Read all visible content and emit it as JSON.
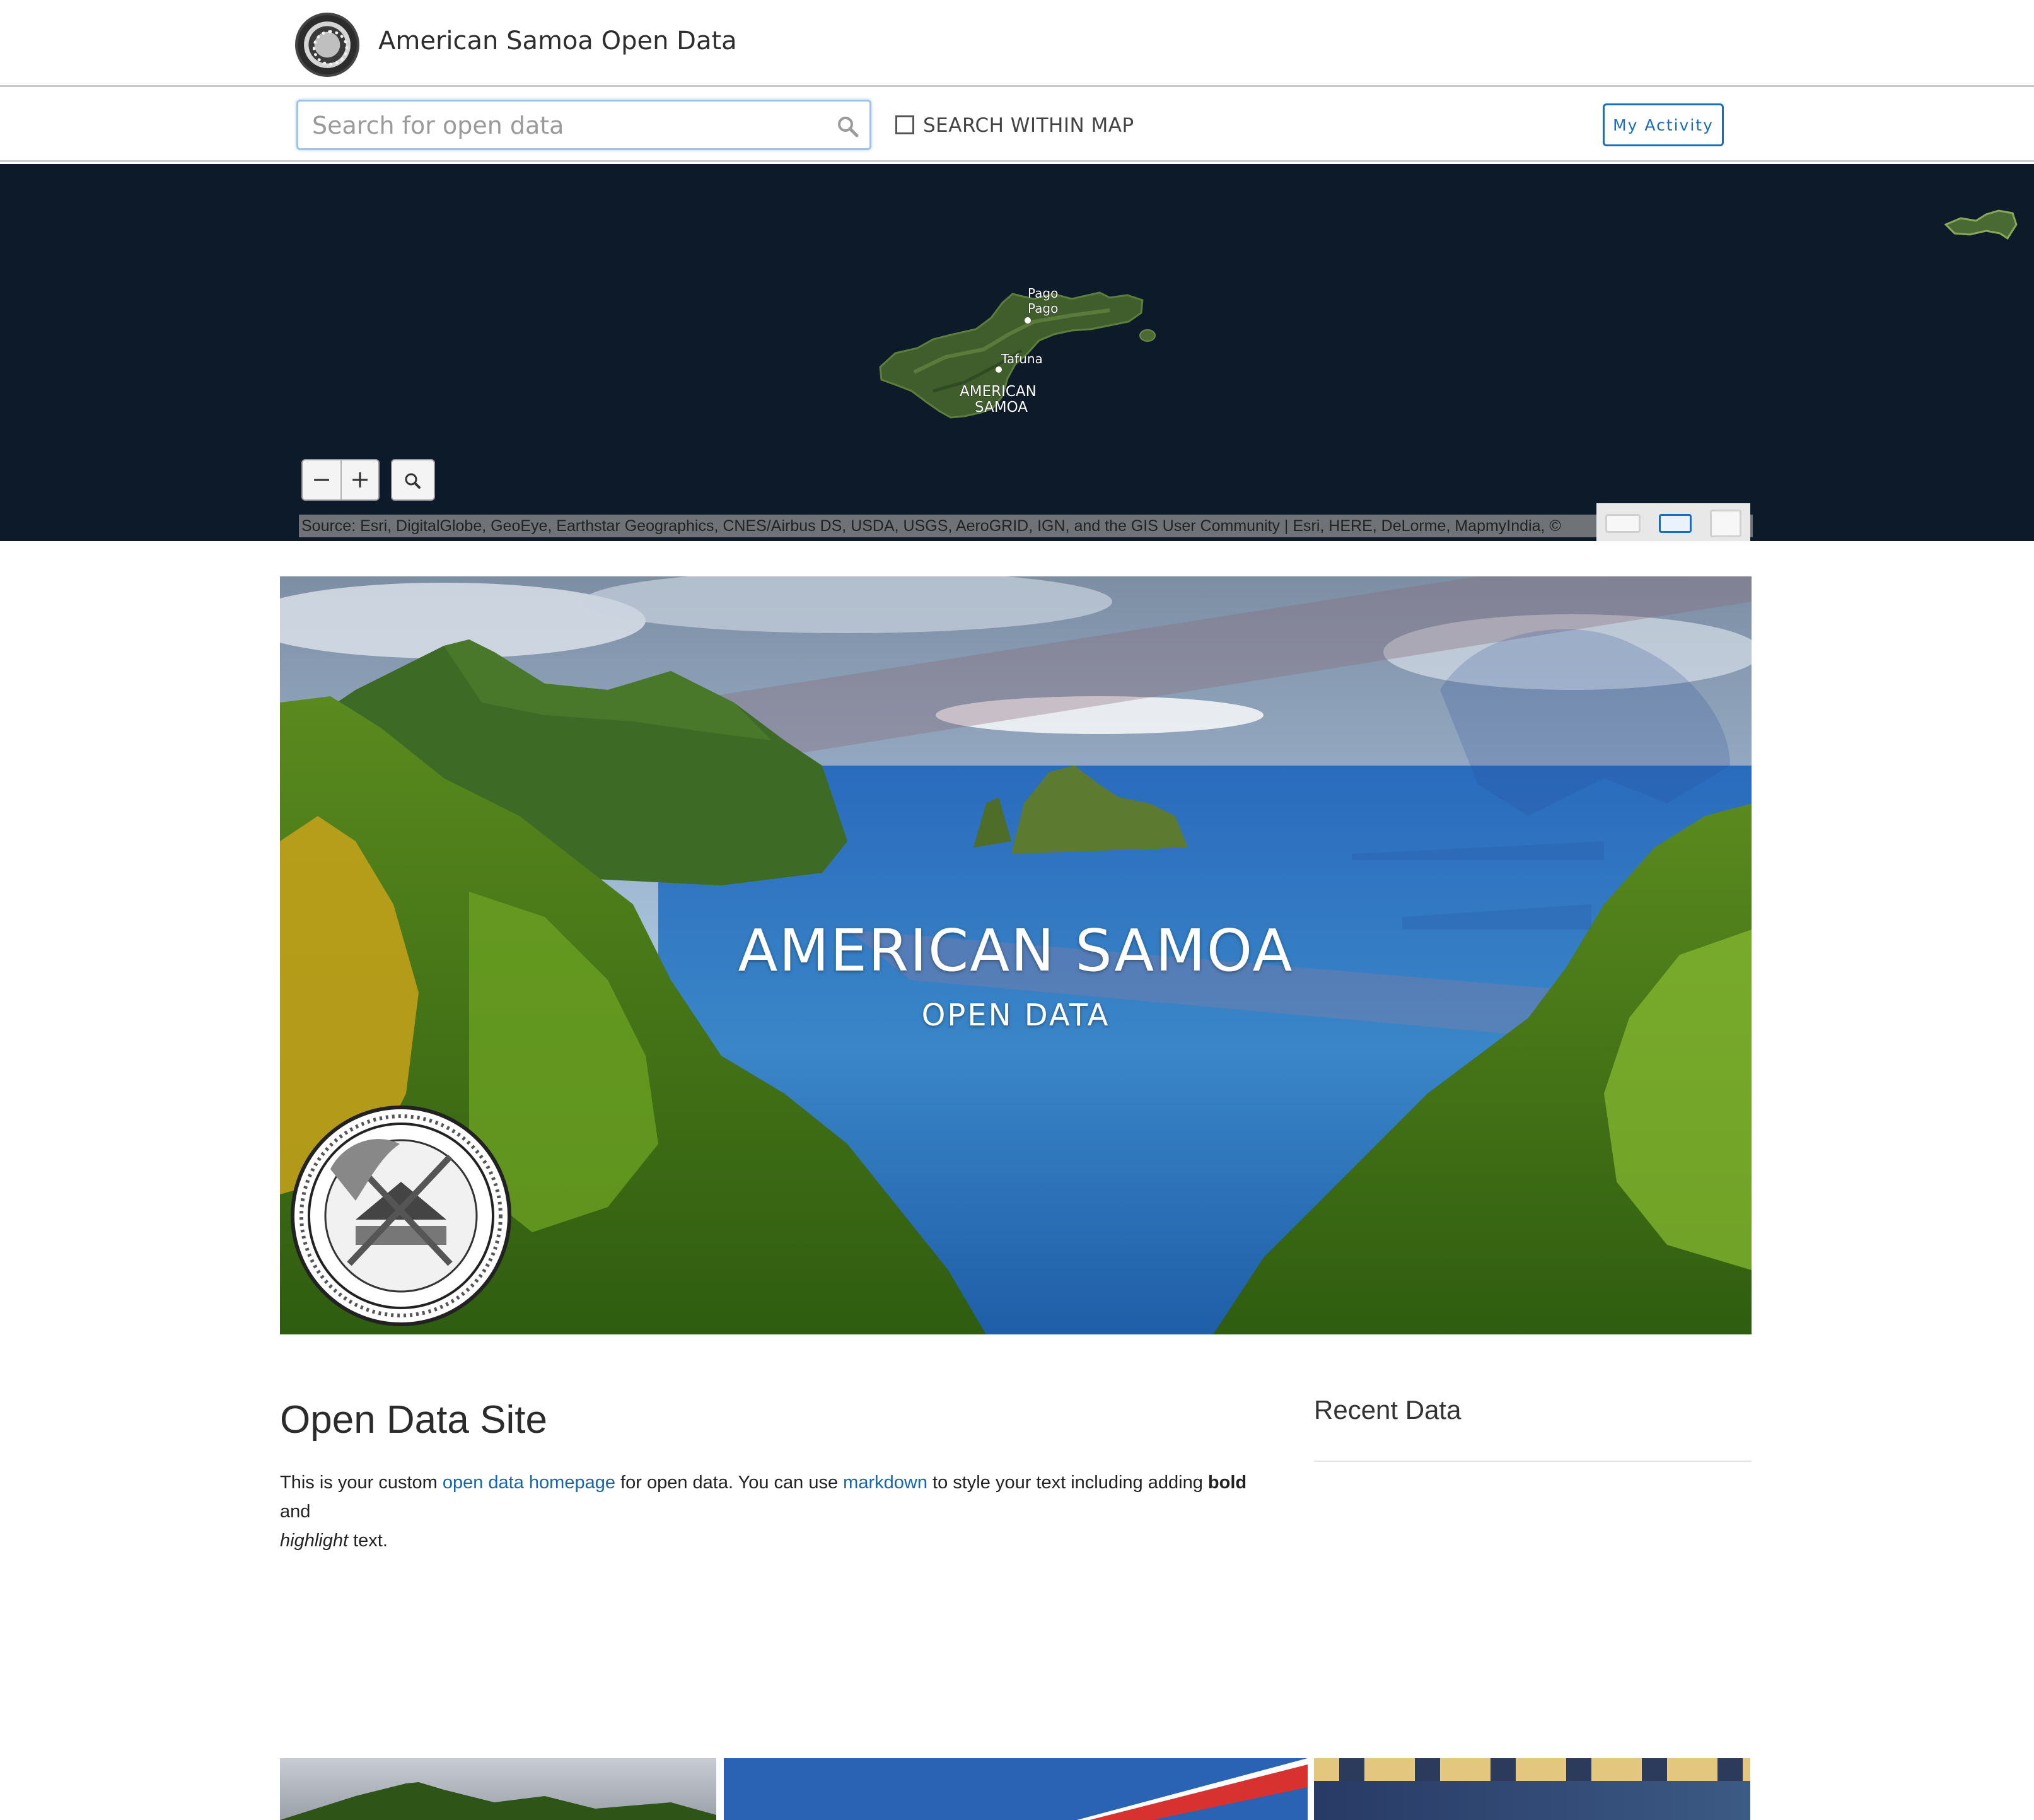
{
  "header": {
    "site_title": "American Samoa Open Data",
    "logo_icon": "american-samoa-seal-icon"
  },
  "toolbar": {
    "search_placeholder": "Search for open data",
    "search_icon": "search-icon",
    "search_within_map_label": "SEARCH WITHIN MAP",
    "search_within_map_checked": false,
    "my_activity_label": "My Activity",
    "accent_color": "#1a6db8"
  },
  "map": {
    "place_labels": {
      "pago_pago_line1": "Pago",
      "pago_pago_line2": "Pago",
      "tafuna": "Tafuna",
      "territory_line1": "AMERICAN",
      "territory_line2": "SAMOA"
    },
    "zoom_out_label": "−",
    "zoom_in_label": "+",
    "attribution": "Source: Esri, DigitalGlobe, GeoEye, Earthstar Geographics, CNES/Airbus DS, USDA, USGS, AeroGRID, IGN, and the GIS User Community |  Esri, HERE, DeLorme, MapmyIndia, ©",
    "basemap_options": [
      "streets",
      "imagery",
      "topographic"
    ],
    "basemap_selected": "imagery"
  },
  "hero": {
    "title": "AMERICAN SAMOA",
    "subtitle": "OPEN DATA",
    "seal_icon": "american-samoa-seal-icon"
  },
  "main": {
    "title": "Open Data Site",
    "text_1": "This is your custom ",
    "link_1": "open data homepage",
    "text_2": " for open data. You can use ",
    "link_2": "markdown",
    "text_3": " to style your text including adding ",
    "bold": "bold",
    "text_4": " and",
    "italic": "highlight",
    "text_5": " text."
  },
  "sidebar": {
    "recent_title": "Recent Data"
  }
}
